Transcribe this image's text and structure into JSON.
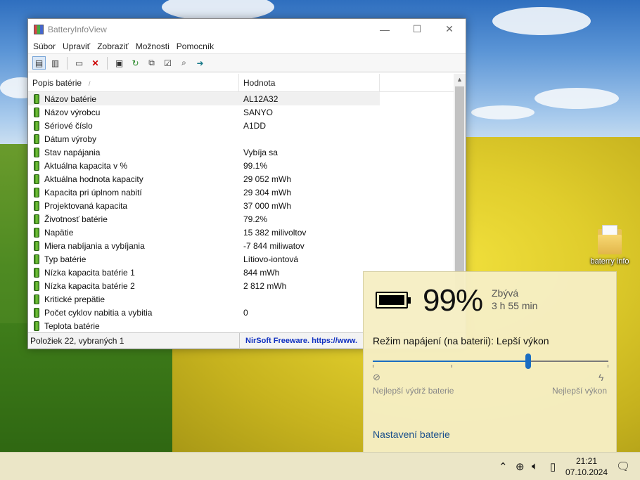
{
  "window": {
    "title": "BatteryInfoView",
    "minimize": "—",
    "maximize": "☐",
    "close": "✕"
  },
  "menu": [
    "Súbor",
    "Upraviť",
    "Zobraziť",
    "Možnosti",
    "Pomocník"
  ],
  "toolbar": {
    "icons": [
      "details-view-icon",
      "log-view-icon",
      "window-icon",
      "delete-icon",
      "save-icon",
      "refresh-icon",
      "copy-icon",
      "properties-icon",
      "find-icon",
      "exit-icon"
    ]
  },
  "table": {
    "columns": [
      "Popis batérie",
      "Hodnota"
    ],
    "sort_indicator": "/",
    "rows": [
      [
        "Názov batérie",
        "AL12A32"
      ],
      [
        "Názov výrobcu",
        "SANYO"
      ],
      [
        "Sériové číslo",
        "A1DD"
      ],
      [
        "Dátum výroby",
        ""
      ],
      [
        "Stav napájania",
        "Vybíja sa"
      ],
      [
        "Aktuálna kapacita v %",
        "99.1%"
      ],
      [
        "Aktuálna hodnota kapacity",
        "29 052 mWh"
      ],
      [
        "Kapacita pri úplnom nabití",
        "29 304 mWh"
      ],
      [
        "Projektovaná kapacita",
        "37 000 mWh"
      ],
      [
        "Životnosť batérie",
        "79.2%"
      ],
      [
        "Napätie",
        "15 382 milivoltov"
      ],
      [
        "Miera nabíjania a vybíjania",
        "-7 844 miliwatov"
      ],
      [
        "Typ batérie",
        "Lítiovo-iontová"
      ],
      [
        "Nízka kapacita batérie 1",
        "844 mWh"
      ],
      [
        "Nízka kapacita batérie 2",
        "2 812 mWh"
      ],
      [
        "Kritické prepätie",
        ""
      ],
      [
        "Počet cyklov nabitia a vybitia",
        "0"
      ],
      [
        "Teplota batérie",
        ""
      ]
    ]
  },
  "statusbar": {
    "count": "Položiek 22, vybraných 1",
    "credit": "NirSoft Freeware. https://www."
  },
  "desktop": {
    "icon_label": "baterry info"
  },
  "flyout": {
    "percent": "99%",
    "remaining_label": "Zbývá",
    "remaining_value": "3 h 55 min",
    "mode_text": "Režim napájení (na baterii): Lepší výkon",
    "slider_level": 0.66,
    "left_label": "Nejlepší výdrž baterie",
    "right_label": "Nejlepší výkon",
    "settings_link": "Nastavení baterie"
  },
  "taskbar": {
    "time": "21:21",
    "date": "07.10.2024"
  }
}
